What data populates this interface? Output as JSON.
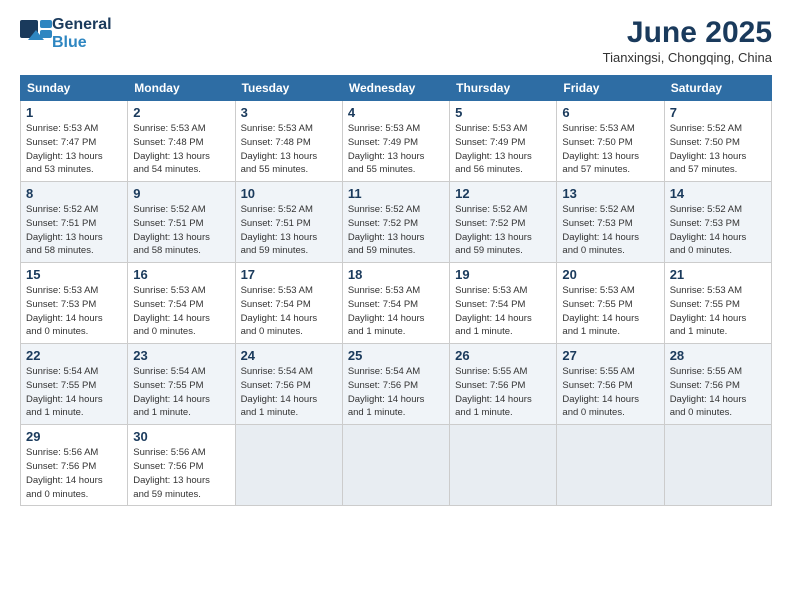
{
  "header": {
    "logo_line1": "General",
    "logo_line2": "Blue",
    "month": "June 2025",
    "location": "Tianxingsi, Chongqing, China"
  },
  "weekdays": [
    "Sunday",
    "Monday",
    "Tuesday",
    "Wednesday",
    "Thursday",
    "Friday",
    "Saturday"
  ],
  "weeks": [
    [
      {
        "day": "1",
        "info": "Sunrise: 5:53 AM\nSunset: 7:47 PM\nDaylight: 13 hours\nand 53 minutes."
      },
      {
        "day": "2",
        "info": "Sunrise: 5:53 AM\nSunset: 7:48 PM\nDaylight: 13 hours\nand 54 minutes."
      },
      {
        "day": "3",
        "info": "Sunrise: 5:53 AM\nSunset: 7:48 PM\nDaylight: 13 hours\nand 55 minutes."
      },
      {
        "day": "4",
        "info": "Sunrise: 5:53 AM\nSunset: 7:49 PM\nDaylight: 13 hours\nand 55 minutes."
      },
      {
        "day": "5",
        "info": "Sunrise: 5:53 AM\nSunset: 7:49 PM\nDaylight: 13 hours\nand 56 minutes."
      },
      {
        "day": "6",
        "info": "Sunrise: 5:53 AM\nSunset: 7:50 PM\nDaylight: 13 hours\nand 57 minutes."
      },
      {
        "day": "7",
        "info": "Sunrise: 5:52 AM\nSunset: 7:50 PM\nDaylight: 13 hours\nand 57 minutes."
      }
    ],
    [
      {
        "day": "8",
        "info": "Sunrise: 5:52 AM\nSunset: 7:51 PM\nDaylight: 13 hours\nand 58 minutes."
      },
      {
        "day": "9",
        "info": "Sunrise: 5:52 AM\nSunset: 7:51 PM\nDaylight: 13 hours\nand 58 minutes."
      },
      {
        "day": "10",
        "info": "Sunrise: 5:52 AM\nSunset: 7:51 PM\nDaylight: 13 hours\nand 59 minutes."
      },
      {
        "day": "11",
        "info": "Sunrise: 5:52 AM\nSunset: 7:52 PM\nDaylight: 13 hours\nand 59 minutes."
      },
      {
        "day": "12",
        "info": "Sunrise: 5:52 AM\nSunset: 7:52 PM\nDaylight: 13 hours\nand 59 minutes."
      },
      {
        "day": "13",
        "info": "Sunrise: 5:52 AM\nSunset: 7:53 PM\nDaylight: 14 hours\nand 0 minutes."
      },
      {
        "day": "14",
        "info": "Sunrise: 5:52 AM\nSunset: 7:53 PM\nDaylight: 14 hours\nand 0 minutes."
      }
    ],
    [
      {
        "day": "15",
        "info": "Sunrise: 5:53 AM\nSunset: 7:53 PM\nDaylight: 14 hours\nand 0 minutes."
      },
      {
        "day": "16",
        "info": "Sunrise: 5:53 AM\nSunset: 7:54 PM\nDaylight: 14 hours\nand 0 minutes."
      },
      {
        "day": "17",
        "info": "Sunrise: 5:53 AM\nSunset: 7:54 PM\nDaylight: 14 hours\nand 0 minutes."
      },
      {
        "day": "18",
        "info": "Sunrise: 5:53 AM\nSunset: 7:54 PM\nDaylight: 14 hours\nand 1 minute."
      },
      {
        "day": "19",
        "info": "Sunrise: 5:53 AM\nSunset: 7:54 PM\nDaylight: 14 hours\nand 1 minute."
      },
      {
        "day": "20",
        "info": "Sunrise: 5:53 AM\nSunset: 7:55 PM\nDaylight: 14 hours\nand 1 minute."
      },
      {
        "day": "21",
        "info": "Sunrise: 5:53 AM\nSunset: 7:55 PM\nDaylight: 14 hours\nand 1 minute."
      }
    ],
    [
      {
        "day": "22",
        "info": "Sunrise: 5:54 AM\nSunset: 7:55 PM\nDaylight: 14 hours\nand 1 minute."
      },
      {
        "day": "23",
        "info": "Sunrise: 5:54 AM\nSunset: 7:55 PM\nDaylight: 14 hours\nand 1 minute."
      },
      {
        "day": "24",
        "info": "Sunrise: 5:54 AM\nSunset: 7:56 PM\nDaylight: 14 hours\nand 1 minute."
      },
      {
        "day": "25",
        "info": "Sunrise: 5:54 AM\nSunset: 7:56 PM\nDaylight: 14 hours\nand 1 minute."
      },
      {
        "day": "26",
        "info": "Sunrise: 5:55 AM\nSunset: 7:56 PM\nDaylight: 14 hours\nand 1 minute."
      },
      {
        "day": "27",
        "info": "Sunrise: 5:55 AM\nSunset: 7:56 PM\nDaylight: 14 hours\nand 0 minutes."
      },
      {
        "day": "28",
        "info": "Sunrise: 5:55 AM\nSunset: 7:56 PM\nDaylight: 14 hours\nand 0 minutes."
      }
    ],
    [
      {
        "day": "29",
        "info": "Sunrise: 5:56 AM\nSunset: 7:56 PM\nDaylight: 14 hours\nand 0 minutes."
      },
      {
        "day": "30",
        "info": "Sunrise: 5:56 AM\nSunset: 7:56 PM\nDaylight: 13 hours\nand 59 minutes."
      },
      {
        "day": "",
        "info": ""
      },
      {
        "day": "",
        "info": ""
      },
      {
        "day": "",
        "info": ""
      },
      {
        "day": "",
        "info": ""
      },
      {
        "day": "",
        "info": ""
      }
    ]
  ]
}
